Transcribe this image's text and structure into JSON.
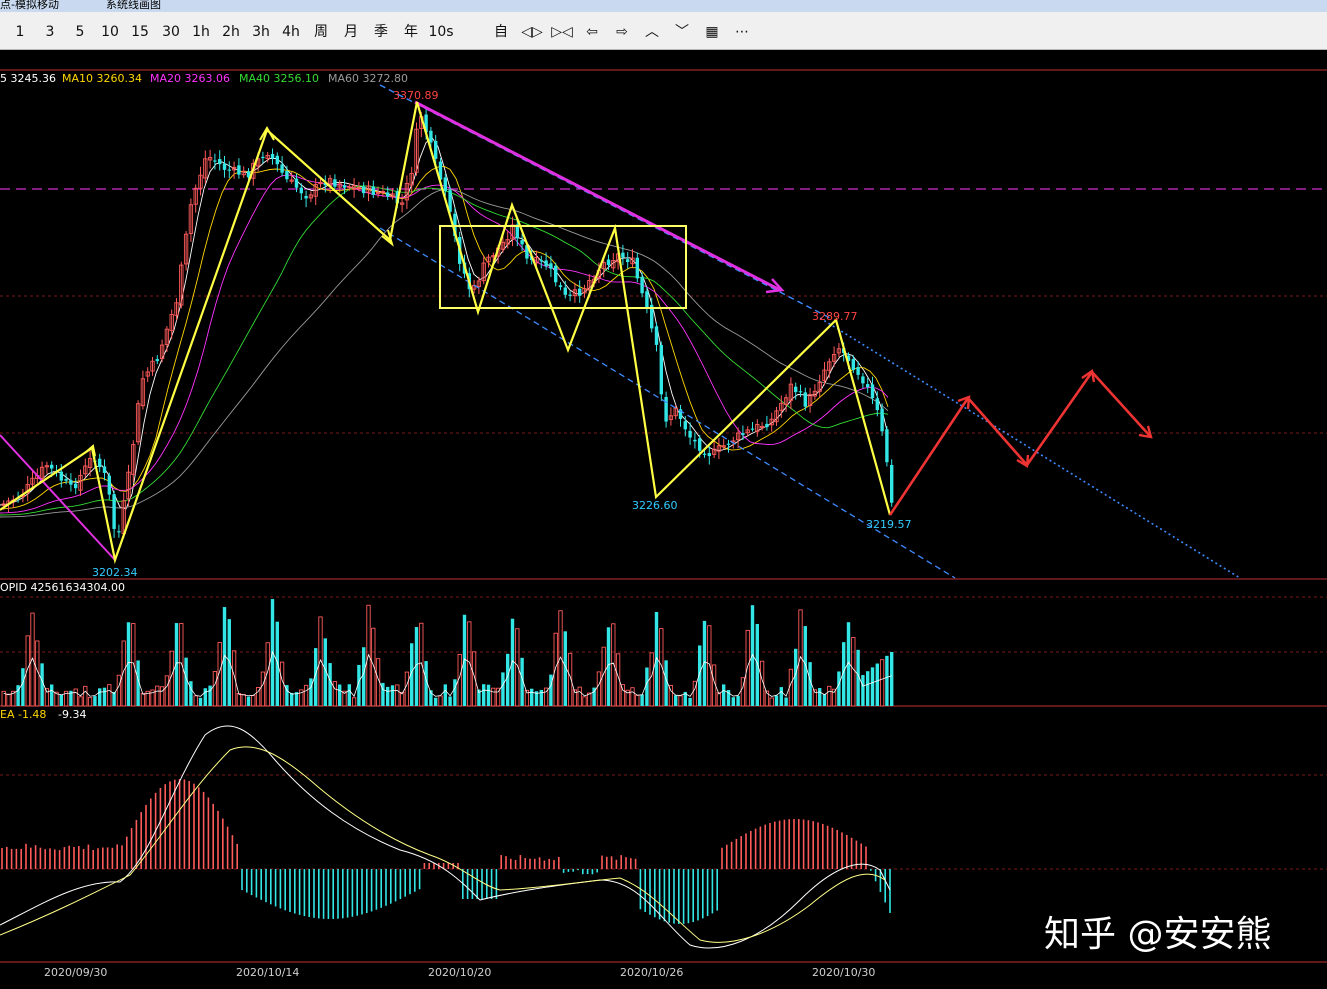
{
  "window": {
    "title_fragments": [
      "点-模拟移动",
      "系统线画图"
    ]
  },
  "toolbar": {
    "items": [
      "1",
      "3",
      "5",
      "10",
      "15",
      "30",
      "1h",
      "2h",
      "3h",
      "4h",
      "周",
      "月",
      "季",
      "年",
      "10s",
      "自",
      "◁▷",
      "▷◁",
      "⇦",
      "⇨",
      "︿",
      "﹀",
      "▦",
      "⋯"
    ]
  },
  "main_panel": {
    "ma_labels": [
      {
        "text": "5 3245.36",
        "color": "#ffffff"
      },
      {
        "text": "MA10 3260.34",
        "color": "#ffd700"
      },
      {
        "text": "MA20 3263.06",
        "color": "#ff33ff"
      },
      {
        "text": "MA40 3256.10",
        "color": "#33dd33"
      },
      {
        "text": "MA60 3272.80",
        "color": "#9a9a9a"
      }
    ],
    "annotations": {
      "high_top": "3370.89",
      "high_right": "3289.77",
      "low_left": "3202.34",
      "low_mid": "3226.60",
      "low_right": "3219.57"
    }
  },
  "volume_panel": {
    "label": "OPID 42561634304.00"
  },
  "macd_panel": {
    "label_dea": "EA -1.48",
    "label_value": "-9.34"
  },
  "x_axis": {
    "dates": [
      "2020/09/30",
      "2020/10/14",
      "2020/10/20",
      "2020/10/26",
      "2020/10/30"
    ]
  },
  "watermark": "知乎 @安安熊",
  "colors": {
    "up": "#ff5b5b",
    "down": "#33e6e6",
    "annotation_red": "#ff4444",
    "annotation_cyan": "#33ccff",
    "trend_yellow": "#ffff44",
    "trend_magenta": "#e030e0",
    "channel_blue": "#3d8bff",
    "projection_red": "#ee3333"
  }
}
